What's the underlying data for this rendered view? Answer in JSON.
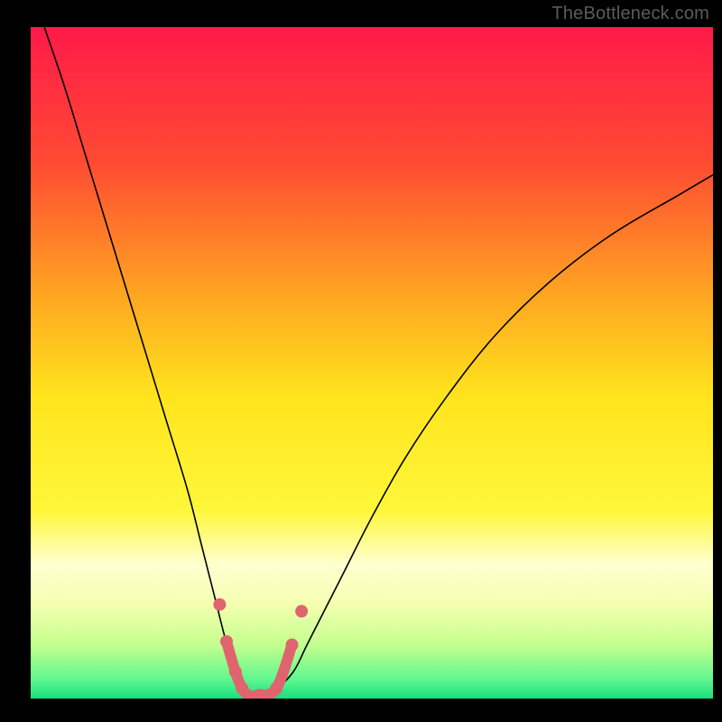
{
  "watermark": "TheBottleneck.com",
  "chart_data": {
    "type": "line",
    "title": "",
    "xlabel": "",
    "ylabel": "",
    "xlim": [
      0,
      100
    ],
    "ylim": [
      0,
      100
    ],
    "legend": false,
    "grid": false,
    "background_gradient": {
      "stops": [
        {
          "offset": 0.0,
          "color": "#ff1a49"
        },
        {
          "offset": 0.2,
          "color": "#ff4a33"
        },
        {
          "offset": 0.4,
          "color": "#ffa621"
        },
        {
          "offset": 0.55,
          "color": "#ffe41d"
        },
        {
          "offset": 0.72,
          "color": "#fff73a"
        },
        {
          "offset": 0.8,
          "color": "#ffffd0"
        },
        {
          "offset": 0.86,
          "color": "#f4ffb0"
        },
        {
          "offset": 0.92,
          "color": "#c4ff8e"
        },
        {
          "offset": 0.97,
          "color": "#63f78f"
        },
        {
          "offset": 1.0,
          "color": "#17e07f"
        }
      ]
    },
    "series": [
      {
        "name": "bottleneck-curve",
        "stroke": "#000000",
        "stroke_width": 1.6,
        "x": [
          2,
          5,
          8,
          11,
          14,
          17,
          20,
          23,
          25,
          27,
          28.5,
          30,
          31,
          32,
          33.5,
          36,
          38.5,
          40.5,
          43,
          46,
          50,
          55,
          61,
          68,
          76,
          85,
          95,
          100
        ],
        "values": [
          100,
          91,
          81,
          71,
          61,
          51,
          41,
          31,
          23,
          15,
          9,
          4,
          1.5,
          0.5,
          0.5,
          1.5,
          4,
          8,
          13,
          19,
          27,
          36,
          45,
          54,
          62,
          69,
          75,
          78
        ]
      },
      {
        "name": "highlight-band",
        "stroke": "#e0646e",
        "stroke_width": 12,
        "x": [
          28.7,
          30,
          31,
          32,
          33.5,
          36,
          38.3
        ],
        "values": [
          8.5,
          4,
          1.5,
          0.5,
          0.5,
          1.5,
          8
        ]
      }
    ],
    "markers": {
      "color": "#e0646e",
      "radius": 7,
      "points": [
        {
          "x": 27.7,
          "y": 14
        },
        {
          "x": 28.7,
          "y": 8.5
        },
        {
          "x": 30,
          "y": 4
        },
        {
          "x": 31,
          "y": 1.5
        },
        {
          "x": 33.5,
          "y": 0.5
        },
        {
          "x": 36,
          "y": 1.5
        },
        {
          "x": 38.3,
          "y": 8
        },
        {
          "x": 39.7,
          "y": 13
        }
      ]
    }
  }
}
